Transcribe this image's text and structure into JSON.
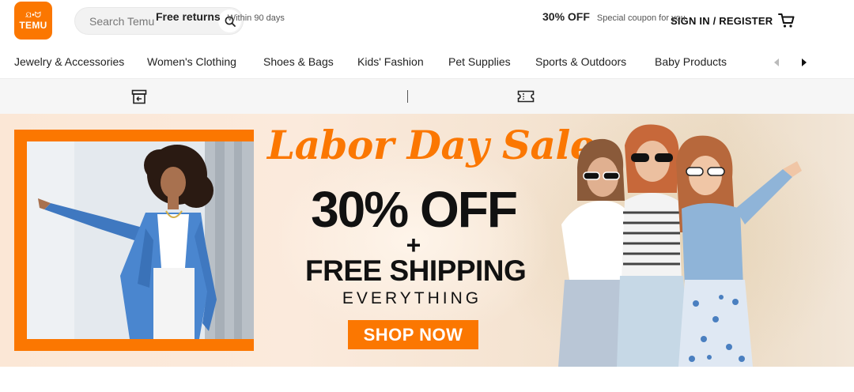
{
  "header": {
    "logo_text": "TEMU",
    "logo_glyphs": "ଯ•ᗢ",
    "search_placeholder": "Search Temu",
    "signin_label": "SIGN IN / REGISTER",
    "cart_icon": "cart-icon",
    "search_icon": "search-icon"
  },
  "categories": [
    "Jewelry & Accessories",
    "Women's Clothing",
    "Shoes & Bags",
    "Kids' Fashion",
    "Pet Supplies",
    "Sports & Outdoors",
    "Baby Products"
  ],
  "promo_strip": {
    "returns_title": "Free returns",
    "returns_sub": "Within 90 days",
    "coupon_title": "30% OFF",
    "coupon_sub": "Special coupon for you"
  },
  "banner": {
    "title": "Labor Day Sale",
    "discount": "30% OFF",
    "plus": "+",
    "shipping": "FREE SHIPPING",
    "everything": "EVERYTHING",
    "cta": "SHOP NOW"
  },
  "colors": {
    "brand": "#fb7701",
    "text": "#222222",
    "strip_bg": "#f6f6f6"
  }
}
